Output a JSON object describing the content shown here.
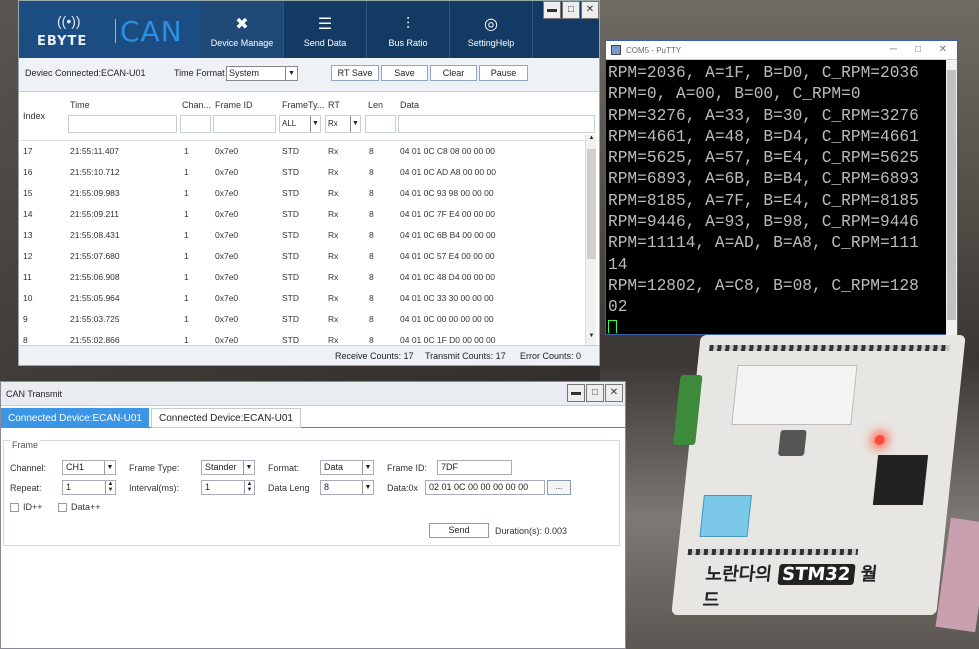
{
  "can_tool": {
    "logo_brand": "EBYTE",
    "logo_product": "CAN",
    "nav": [
      {
        "label": "Device Manage"
      },
      {
        "label": "Send Data"
      },
      {
        "label": "Bus Ratio"
      },
      {
        "label": "SettingHelp"
      }
    ],
    "toolbar": {
      "connected_text": "Deviec Connected:ECAN-U01",
      "time_format_label": "Time Format",
      "time_format_value": "System",
      "buttons": [
        "RT Save",
        "Save",
        "Clear",
        "Pause"
      ]
    },
    "grid": {
      "headers": [
        "Index",
        "Time",
        "Chan...",
        "Frame ID",
        "FrameTy...",
        "RT",
        "Len",
        "Data"
      ],
      "filter_frametype": "ALL",
      "filter_rt": "Rx",
      "rows": [
        {
          "index": "17",
          "time": "21:55:11.407",
          "chan": "1",
          "frame_id": "0x7e0",
          "type": "STD",
          "rt": "Rx",
          "len": "8",
          "data": "04 01 0C C8 08 00 00 00"
        },
        {
          "index": "16",
          "time": "21:55:10.712",
          "chan": "1",
          "frame_id": "0x7e0",
          "type": "STD",
          "rt": "Rx",
          "len": "8",
          "data": "04 01 0C AD A8 00 00 00"
        },
        {
          "index": "15",
          "time": "21:55:09.983",
          "chan": "1",
          "frame_id": "0x7e0",
          "type": "STD",
          "rt": "Rx",
          "len": "8",
          "data": "04 01 0C 93 98 00 00 00"
        },
        {
          "index": "14",
          "time": "21:55:09.211",
          "chan": "1",
          "frame_id": "0x7e0",
          "type": "STD",
          "rt": "Rx",
          "len": "8",
          "data": "04 01 0C 7F E4 00 00 00"
        },
        {
          "index": "13",
          "time": "21:55:08.431",
          "chan": "1",
          "frame_id": "0x7e0",
          "type": "STD",
          "rt": "Rx",
          "len": "8",
          "data": "04 01 0C 6B B4 00 00 00"
        },
        {
          "index": "12",
          "time": "21:55:07.680",
          "chan": "1",
          "frame_id": "0x7e0",
          "type": "STD",
          "rt": "Rx",
          "len": "8",
          "data": "04 01 0C 57 E4 00 00 00"
        },
        {
          "index": "11",
          "time": "21:55:06.908",
          "chan": "1",
          "frame_id": "0x7e0",
          "type": "STD",
          "rt": "Rx",
          "len": "8",
          "data": "04 01 0C 48 D4 00 00 00"
        },
        {
          "index": "10",
          "time": "21:55:05.964",
          "chan": "1",
          "frame_id": "0x7e0",
          "type": "STD",
          "rt": "Rx",
          "len": "8",
          "data": "04 01 0C 33 30 00 00 00"
        },
        {
          "index": "9",
          "time": "21:55:03.725",
          "chan": "1",
          "frame_id": "0x7e0",
          "type": "STD",
          "rt": "Rx",
          "len": "8",
          "data": "04 01 0C 00 00 00 00 00"
        },
        {
          "index": "8",
          "time": "21:55:02.866",
          "chan": "1",
          "frame_id": "0x7e0",
          "type": "STD",
          "rt": "Rx",
          "len": "8",
          "data": "04 01 0C 1F D0 00 00 00"
        }
      ]
    },
    "status": {
      "receive": "Receive Counts:  17",
      "transmit": "Transmit Counts:  17",
      "error": "Error Counts:  0"
    }
  },
  "transmit": {
    "title": "CAN Transmit",
    "tabs": [
      "Connected Device:ECAN-U01",
      "Connected Device:ECAN-U01"
    ],
    "frame_legend": "Frame",
    "channel_label": "Channel:",
    "channel_value": "CH1",
    "frame_type_label": "Frame Type:",
    "frame_type_value": "Stander",
    "format_label": "Format:",
    "format_value": "Data",
    "frame_id_label": "Frame ID:",
    "frame_id_value": "7DF",
    "repeat_label": "Repeat:",
    "repeat_value": "1",
    "interval_label": "Interval(ms):",
    "interval_value": "1",
    "data_len_label": "Data Leng",
    "data_len_value": "8",
    "data_label": "Data:0x",
    "data_value": "02 01 0C 00 00 00 00 00",
    "dots": "...",
    "id_inc": "ID++",
    "data_inc": "Data++",
    "send": "Send",
    "duration": "Duration(s):  0.003"
  },
  "putty": {
    "title": "COM5 - PuTTY",
    "lines": [
      "RPM=2036, A=1F, B=D0, C_RPM=2036",
      "RPM=0, A=00, B=00, C_RPM=0",
      "RPM=3276, A=33, B=30, C_RPM=3276",
      "RPM=4661, A=48, B=D4, C_RPM=4661",
      "RPM=5625, A=57, B=E4, C_RPM=5625",
      "RPM=6893, A=6B, B=B4, C_RPM=6893",
      "RPM=8185, A=7F, B=E4, C_RPM=8185",
      "RPM=9446, A=93, B=98, C_RPM=9446",
      "RPM=11114, A=AD, B=A8, C_RPM=111",
      "14",
      "RPM=12802, A=C8, B=08, C_RPM=128",
      "02"
    ]
  },
  "board": {
    "label_left": "노란다의",
    "label_stm": "STM32",
    "label_right": "월드"
  }
}
